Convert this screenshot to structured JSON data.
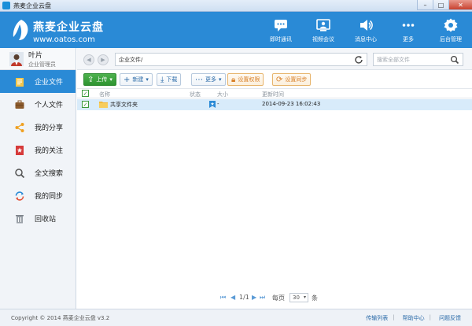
{
  "window": {
    "title": "燕麦企业云盘"
  },
  "header": {
    "brand_name": "燕麦企业云盘",
    "brand_domain": "www.oatos.com",
    "nav": [
      {
        "label": "即时通讯",
        "icon": "chat-icon"
      },
      {
        "label": "视频会议",
        "icon": "video-meeting-icon"
      },
      {
        "label": "消息中心",
        "icon": "speaker-icon"
      },
      {
        "label": "更多",
        "icon": "more-icon"
      },
      {
        "label": "后台管理",
        "icon": "gear-icon"
      }
    ]
  },
  "user": {
    "name": "叶片",
    "role": "企业管理员"
  },
  "sidebar": {
    "items": [
      {
        "label": "企业文件",
        "icon": "enterprise-files-icon",
        "active": true
      },
      {
        "label": "个人文件",
        "icon": "briefcase-icon"
      },
      {
        "label": "我的分享",
        "icon": "share-icon"
      },
      {
        "label": "我的关注",
        "icon": "star-icon"
      },
      {
        "label": "全文搜索",
        "icon": "search-icon"
      },
      {
        "label": "我的同步",
        "icon": "sync-icon"
      },
      {
        "label": "回收站",
        "icon": "trash-icon"
      }
    ]
  },
  "pathbar": {
    "path": "企业文件/",
    "search_placeholder": "搜索全部文件"
  },
  "toolbar": {
    "upload": "上传",
    "new": "新建",
    "download": "下载",
    "more": "更多",
    "permissions": "设置权限",
    "sync": "设置同步"
  },
  "table": {
    "headers": {
      "name": "名称",
      "status": "状态",
      "size": "大小",
      "updated": "更新时间"
    },
    "rows": [
      {
        "name": "共享文件夹",
        "size": "-",
        "updated": "2014-09-23 16:02:43"
      }
    ]
  },
  "pager": {
    "page": "1/1",
    "per_page_label": "每页",
    "per_page": "30",
    "unit": "条"
  },
  "footer": {
    "copyright": "Copyright © 2014 燕麦企业云盘 v3.2",
    "links": [
      "传输列表",
      "帮助中心",
      "问题反馈"
    ]
  },
  "colors": {
    "brand": "#2a8ad6",
    "active_menu": "#2a8ad6",
    "selected_row": "#d8ebfa",
    "upload_green": "#3aa33c"
  }
}
